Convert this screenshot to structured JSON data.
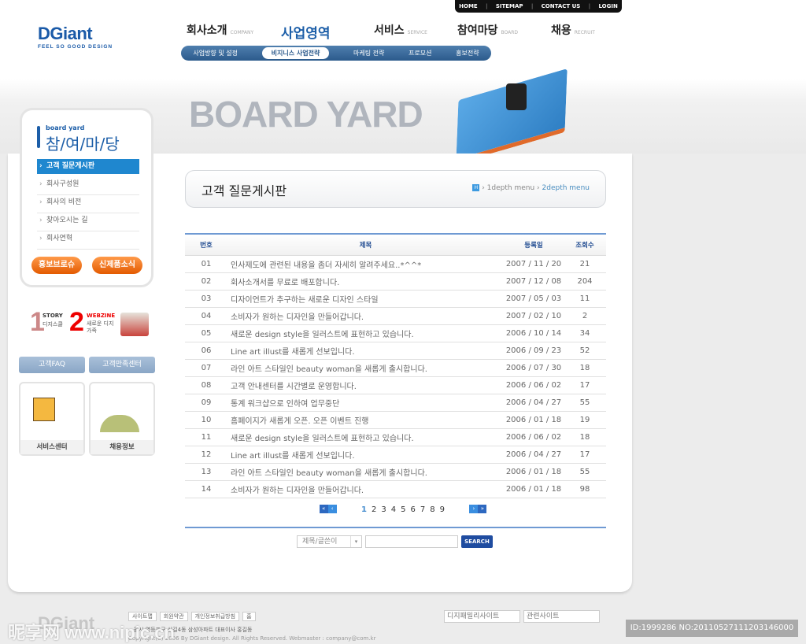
{
  "util_nav": [
    "HOME",
    "SITEMAP",
    "CONTACT US",
    "LOGIN"
  ],
  "logo": {
    "name": "DGiant",
    "tagline": "FEEL SO GOOD DESIGN"
  },
  "gnb": [
    {
      "ko": "회사소개",
      "en": "COMPANY"
    },
    {
      "ko": "사업영역",
      "en": ""
    },
    {
      "ko": "서비스",
      "en": "SERVICE"
    },
    {
      "ko": "참여마당",
      "en": "BOARD"
    },
    {
      "ko": "채용",
      "en": "RECRUIT"
    }
  ],
  "subnav": [
    "사업방향 및 설정",
    "비지니스 사업전략",
    "마케팅 전략",
    "프로모션",
    "홍보전략"
  ],
  "banner": "BOARD YARD",
  "lnb": {
    "en": "board yard",
    "title": "참/여/마/당",
    "items": [
      "고객 질문게시판",
      "회사구성원",
      "회사의 비전",
      "찾아오시는 길",
      "회사연혁"
    ],
    "btn1": "홍보브로슈",
    "btn2": "신제품소식"
  },
  "promo": {
    "n1": "1",
    "t1": "STORY",
    "s1": "디지스쿨",
    "n2": "2",
    "t2": "WEBZINE",
    "s2": "새로운 디지가족"
  },
  "side_buttons": [
    "고객FAQ",
    "고객만족센터"
  ],
  "side_boxes": [
    "서비스센터",
    "채용정보"
  ],
  "page": {
    "title": "고객 질문게시판",
    "breadcrumb": [
      "1depth menu",
      "2depth menu"
    ]
  },
  "table": {
    "headers": [
      "번호",
      "제목",
      "등록일",
      "조회수"
    ],
    "rows": [
      [
        "01",
        "인사제도에 관련된 내용을 좀더 자세히 알려주세요..*^^*",
        "2007 / 11 / 20",
        "21"
      ],
      [
        "02",
        "회사소개서를 무료로 배포합니다.",
        "2007 / 12 / 08",
        "204"
      ],
      [
        "03",
        "디자이언트가 추구하는 새로운 디자인 스타일",
        "2007 / 05 / 03",
        "11"
      ],
      [
        "04",
        "소비자가 원하는 디자인을 만들어갑니다.",
        "2007 / 02 / 10",
        "2"
      ],
      [
        "05",
        "새로운 design style을 일러스트에 표현하고 있습니다.",
        "2006 / 10 / 14",
        "34"
      ],
      [
        "06",
        "Line art illust를 새롭게 선보입니다.",
        "2006 / 09 / 23",
        "52"
      ],
      [
        "07",
        "라인 아트 스타일인 beauty woman을 새롭게 출시합니다.",
        "2006 / 07 / 30",
        "18"
      ],
      [
        "08",
        "고객 안내센터를 시간별로 운영합니다.",
        "2006 / 06 / 02",
        "17"
      ],
      [
        "09",
        "통계 워크샵으로 인하여 업무중단",
        "2006 / 04 / 27",
        "55"
      ],
      [
        "10",
        "홈페이지가 새롭게 오픈. 오픈 이벤트 진행",
        "2006 / 01 / 18",
        "19"
      ],
      [
        "11",
        "새로운 design style을 일러스트에 표현하고 있습니다.",
        "2006 / 06 / 02",
        "18"
      ],
      [
        "12",
        "Line art illust를 새롭게 선보입니다.",
        "2006 / 04 / 27",
        "17"
      ],
      [
        "13",
        "라인 아트 스타일인 beauty woman을 새롭게 출시합니다.",
        "2006 / 01 / 18",
        "55"
      ],
      [
        "14",
        "소비자가 원하는 디자인을 만들어갑니다.",
        "2006 / 01 / 18",
        "98"
      ]
    ]
  },
  "pagination": {
    "pages": [
      "1",
      "2",
      "3",
      "4",
      "5",
      "6",
      "7",
      "8",
      "9"
    ],
    "current": "1",
    "first": "«",
    "prev": "‹",
    "next": "›",
    "last": "»"
  },
  "search": {
    "select": "제목/글쓴이",
    "value": "",
    "button": "SEARCH"
  },
  "footer": {
    "links": [
      "사이트맵",
      "회원약관",
      "개인정보취급방침",
      "홈"
    ],
    "address": "...울시 영등포구 신길4동 삼성아파트  대표이사 홍길동",
    "copyright": "Copyright(C) 2006 By DGiant design. All Rights Reserved. Webmaster : company@com.kr",
    "family": "디지패밀리사이트",
    "related": "관련사이트",
    "logo": "DGiant"
  },
  "watermark": {
    "left": "昵享网 www.nipic.cn",
    "right": "ID:1999286 NO:20110527111203146000"
  }
}
